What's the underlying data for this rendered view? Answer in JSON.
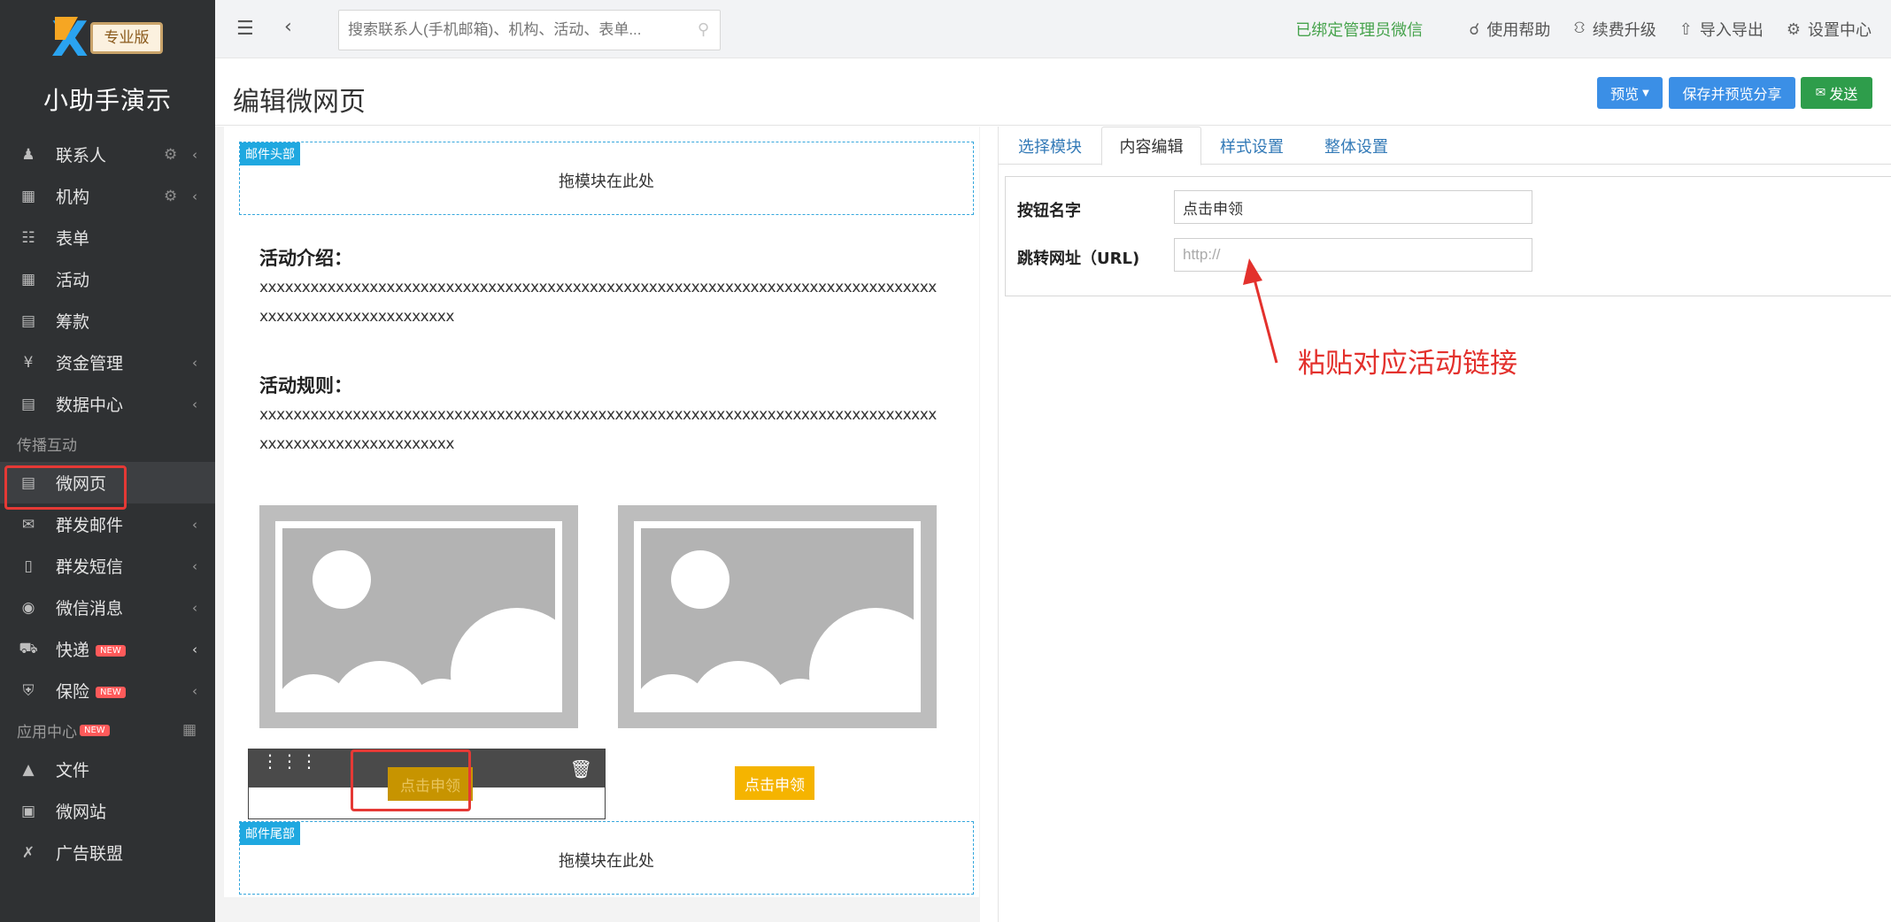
{
  "colors": {
    "sidebar_bg": "#2f3133",
    "accent_blue": "#3b8fe6",
    "send_green": "#2e9d4b",
    "cta_yellow": "#f5b400",
    "annotation_red": "#e3312d",
    "wx_green": "#47a34d"
  },
  "sidebar": {
    "logo_badge": "专业版",
    "brand": "小助手演示",
    "items": [
      {
        "label": "联系人",
        "icon": "users-icon",
        "gear": true,
        "chevron": true
      },
      {
        "label": "机构",
        "icon": "building-icon",
        "gear": true,
        "chevron": true
      },
      {
        "label": "表单",
        "icon": "clipboard-icon"
      },
      {
        "label": "活动",
        "icon": "calendar-icon"
      },
      {
        "label": "筹款",
        "icon": "money-icon"
      },
      {
        "label": "资金管理",
        "icon": "yen-icon",
        "chevron": true
      },
      {
        "label": "数据中心",
        "icon": "database-icon",
        "chevron": true
      }
    ],
    "section1": "传播互动",
    "items2": [
      {
        "label": "微网页",
        "icon": "document-icon",
        "active": true
      },
      {
        "label": "群发邮件",
        "icon": "envelope-icon",
        "chevron": true
      },
      {
        "label": "群发短信",
        "icon": "mobile-icon",
        "chevron": true
      },
      {
        "label": "微信消息",
        "icon": "wechat-icon",
        "chevron": true
      },
      {
        "label": "快递",
        "icon": "truck-icon",
        "badge": "NEW",
        "chevron": true
      },
      {
        "label": "保险",
        "icon": "shield-icon",
        "badge": "NEW",
        "chevron": true
      }
    ],
    "section2": "应用中心",
    "section2_badge": "NEW",
    "items3": [
      {
        "label": "文件",
        "icon": "folder-icon"
      },
      {
        "label": "微网站",
        "icon": "site-icon"
      },
      {
        "label": "广告联盟",
        "icon": "ad-icon"
      }
    ]
  },
  "topbar": {
    "search_placeholder": "搜索联系人(手机邮箱)、机构、活动、表单...",
    "wx_status": "已绑定管理员微信",
    "links": [
      "使用帮助",
      "续费升级",
      "导入导出",
      "设置中心"
    ]
  },
  "header": {
    "title": "编辑微网页",
    "preview": "预览",
    "save_share": "保存并预览分享",
    "send": "发送"
  },
  "canvas": {
    "header_tag": "邮件头部",
    "footer_tag": "邮件尾部",
    "drop_text": "拖模块在此处",
    "intro_title": "活动介绍：",
    "intro_body": "xxxxxxxxxxxxxxxxxxxxxxxxxxxxxxxxxxxxxxxxxxxxxxxxxxxxxxxxxxxxxxxxxxxxxxxxxxxxxxxxxxxxxxxxxxxxxxxxxxxxxxx",
    "rules_title": "活动规则：",
    "rules_body": "xxxxxxxxxxxxxxxxxxxxxxxxxxxxxxxxxxxxxxxxxxxxxxxxxxxxxxxxxxxxxxxxxxxxxxxxxxxxxxxxxxxxxxxxxxxxxxxxxxxxxxx",
    "cta_left": "点击申领",
    "cta_right": "点击申领"
  },
  "panel": {
    "tabs": [
      "选择模块",
      "内容编辑",
      "样式设置",
      "整体设置"
    ],
    "active_tab": "内容编辑",
    "button_name_label": "按钮名字",
    "button_name_value": "点击申领",
    "url_label": "跳转网址（URL)",
    "url_placeholder": "http://",
    "annotation": "粘贴对应活动链接"
  }
}
